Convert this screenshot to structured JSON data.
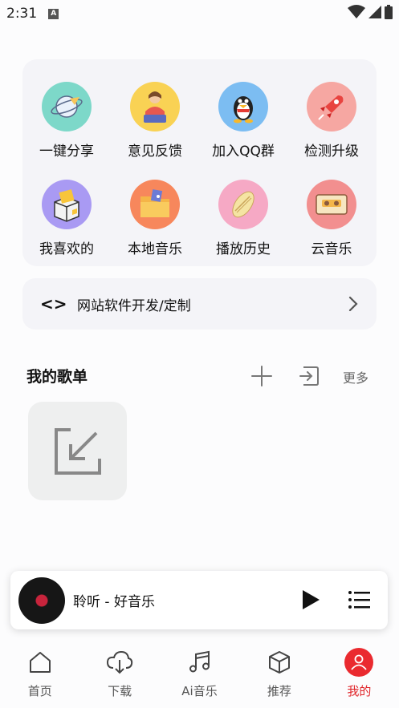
{
  "status_bar": {
    "time": "2:31",
    "notification_badge": "A"
  },
  "grid": [
    {
      "label": "一键分享",
      "icon": "share-planet-icon",
      "color": "#7dd8c9"
    },
    {
      "label": "意见反馈",
      "icon": "feedback-person-icon",
      "color": "#f9d254"
    },
    {
      "label": "加入QQ群",
      "icon": "qq-penguin-icon",
      "color": "#7cbdf2"
    },
    {
      "label": "检测升级",
      "icon": "rocket-update-icon",
      "color": "#f6a7a2"
    },
    {
      "label": "我喜欢的",
      "icon": "favorite-box-icon",
      "color": "#a99af3"
    },
    {
      "label": "本地音乐",
      "icon": "local-folder-icon",
      "color": "#f7875c"
    },
    {
      "label": "播放历史",
      "icon": "history-record-icon",
      "color": "#f6a9c5"
    },
    {
      "label": "云音乐",
      "icon": "cloud-cassette-icon",
      "color": "#f28f8f"
    }
  ],
  "dev_bar": {
    "code_symbol": "<>",
    "text": "网站软件开发/定制"
  },
  "playlist": {
    "title": "我的歌单",
    "more": "更多"
  },
  "mini_player": {
    "title": "聆听 - 好音乐"
  },
  "nav": [
    {
      "label": "首页",
      "icon": "home-icon"
    },
    {
      "label": "下载",
      "icon": "cloud-download-icon"
    },
    {
      "label": "Ai音乐",
      "icon": "music-note-icon"
    },
    {
      "label": "推荐",
      "icon": "cube-icon"
    },
    {
      "label": "我的",
      "icon": "user-icon",
      "active": true
    }
  ],
  "colors": {
    "accent": "#ea2a2f",
    "card_bg": "#f4f4f8"
  }
}
